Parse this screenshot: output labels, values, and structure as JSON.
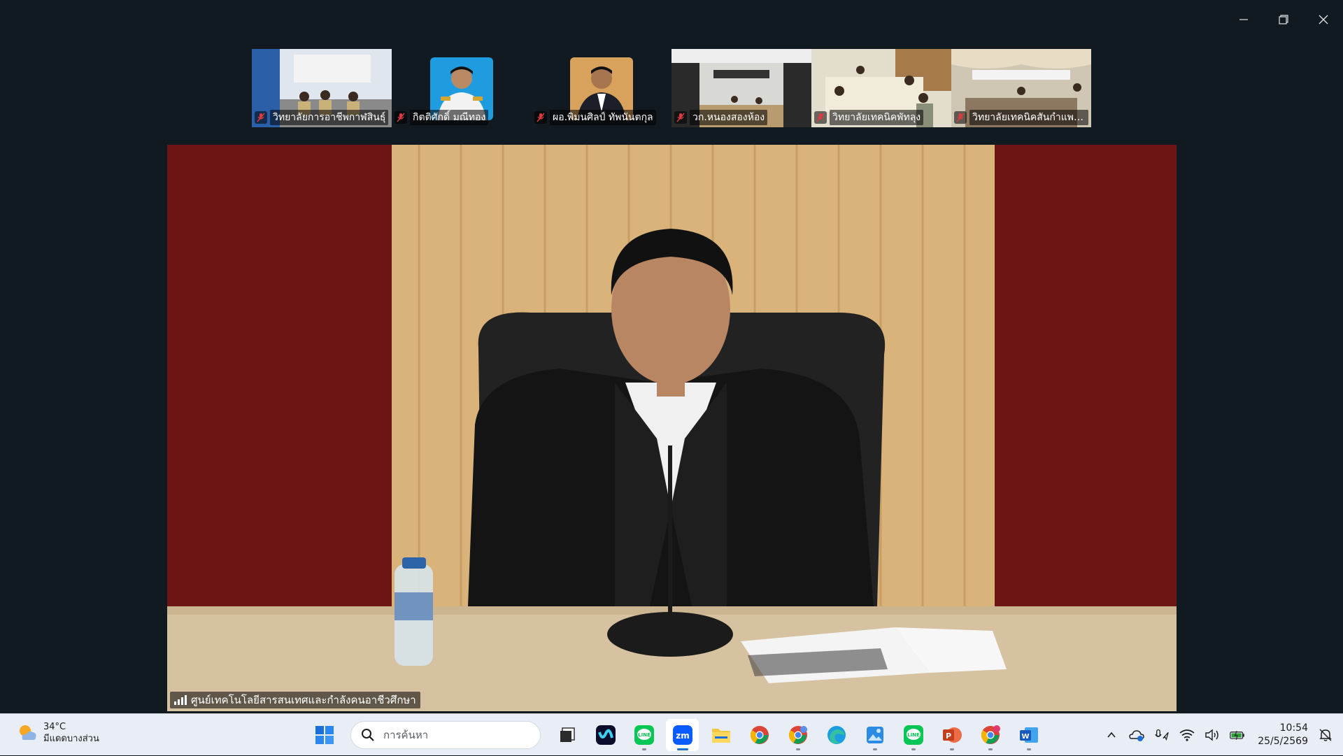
{
  "window": {
    "controls": {
      "minimize": "minimize-icon",
      "restore": "restore-icon",
      "close": "close-icon"
    }
  },
  "participants": [
    {
      "name": "วิทยาลัยการอาชีพกาฬสินธุ์",
      "muted": true,
      "video": "room"
    },
    {
      "name": "กิตติศักดิ์ มณีทอง",
      "muted": true,
      "video": "portrait"
    },
    {
      "name": "ผอ.พิมนศิลป์ ทัพนันตกุล",
      "muted": true,
      "video": "portrait"
    },
    {
      "name": "วก.หนองสองห้อง",
      "muted": true,
      "video": "room"
    },
    {
      "name": "วิทยาลัยเทคนิคพัทลุง",
      "muted": true,
      "video": "room"
    },
    {
      "name": "วิทยาลัยเทคนิคสันกำแพง...",
      "muted": true,
      "video": "room"
    }
  ],
  "main_video": {
    "speaker_label": "ศูนย์เทคโนโลยีสารสนเทศและกำลังคนอาชีวศึกษา",
    "signal_icon": "signal-bars-icon"
  },
  "taskbar": {
    "weather": {
      "temp": "34°C",
      "condition": "มีแดดบางส่วน",
      "icon": "partly-sunny-icon"
    },
    "search_placeholder": "การค้นหา",
    "apps": [
      {
        "name": "start",
        "icon": "windows-start-icon"
      },
      {
        "name": "task-view",
        "icon": "task-view-icon"
      },
      {
        "name": "webex",
        "icon": "webex-icon"
      },
      {
        "name": "line",
        "icon": "line-app-icon"
      },
      {
        "name": "zoom",
        "icon": "zoom-app-icon",
        "active": true
      },
      {
        "name": "file-explorer",
        "icon": "folder-icon"
      },
      {
        "name": "chrome",
        "icon": "chrome-icon"
      },
      {
        "name": "chrome-profile",
        "icon": "chrome-icon"
      },
      {
        "name": "edge",
        "icon": "edge-icon"
      },
      {
        "name": "photos",
        "icon": "photos-icon"
      },
      {
        "name": "line-2",
        "icon": "line-app-icon"
      },
      {
        "name": "powerpoint",
        "icon": "powerpoint-icon"
      },
      {
        "name": "chrome-2",
        "icon": "chrome-icon"
      },
      {
        "name": "word",
        "icon": "word-icon"
      }
    ],
    "tray": {
      "time": "10:54",
      "date": "25/5/2569"
    }
  }
}
